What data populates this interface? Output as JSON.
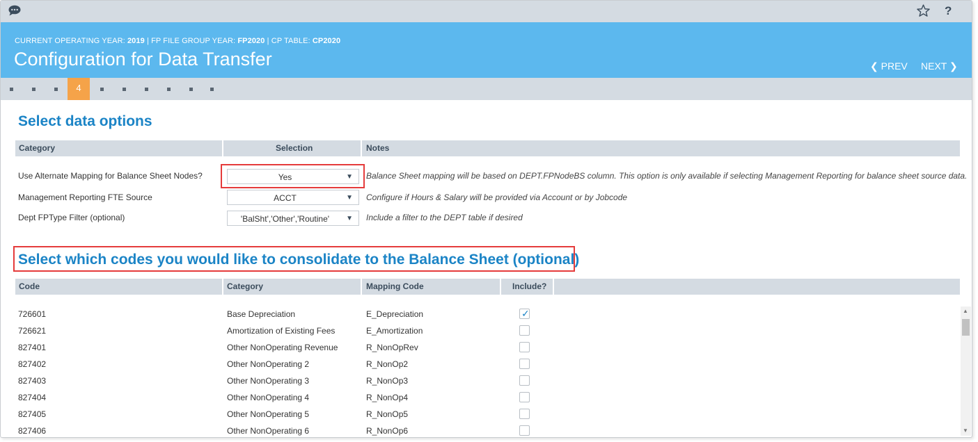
{
  "header": {
    "meta_year_label": "CURRENT OPERATING YEAR:",
    "meta_year": "2019",
    "meta_fp_label": "| FP FILE GROUP YEAR:",
    "meta_fp": "FP2020",
    "meta_cp_label": "| CP TABLE:",
    "meta_cp": "CP2020",
    "title": "Configuration for Data Transfer",
    "prev": "PREV",
    "next": "NEXT",
    "help": "?"
  },
  "steps": {
    "current": "4"
  },
  "options_section": {
    "title": "Select data options",
    "columns": [
      "Category",
      "Selection",
      "Notes"
    ],
    "rows": [
      {
        "label": "Use Alternate Mapping for Balance Sheet Nodes?",
        "selection": "Yes",
        "note": "Balance Sheet mapping will be based on DEPT.FPNodeBS column. This option is only available if selecting Management Reporting for balance sheet source data."
      },
      {
        "label": "Management Reporting FTE Source",
        "selection": "ACCT",
        "note": "Configure if Hours & Salary will be provided via Account or by Jobcode"
      },
      {
        "label": "Dept FPType Filter (optional)",
        "selection": "'BalSht','Other','Routine'",
        "note": "Include a filter to the DEPT table if desired"
      }
    ]
  },
  "codes_section": {
    "title": "Select which codes you would like to consolidate to the Balance Sheet (optional)",
    "columns": [
      "Code",
      "Category",
      "Mapping Code",
      "Include?"
    ],
    "rows": [
      {
        "code": "726601",
        "category": "Base Depreciation",
        "mapping": "E_Depreciation",
        "include": true
      },
      {
        "code": "726621",
        "category": "Amortization of Existing Fees",
        "mapping": "E_Amortization",
        "include": false
      },
      {
        "code": "827401",
        "category": "Other NonOperating Revenue",
        "mapping": "R_NonOpRev",
        "include": false
      },
      {
        "code": "827402",
        "category": "Other NonOperating 2",
        "mapping": "R_NonOp2",
        "include": false
      },
      {
        "code": "827403",
        "category": "Other NonOperating 3",
        "mapping": "R_NonOp3",
        "include": false
      },
      {
        "code": "827404",
        "category": "Other NonOperating 4",
        "mapping": "R_NonOp4",
        "include": false
      },
      {
        "code": "827405",
        "category": "Other NonOperating 5",
        "mapping": "R_NonOp5",
        "include": false
      },
      {
        "code": "827406",
        "category": "Other NonOperating 6",
        "mapping": "R_NonOp6",
        "include": false
      }
    ]
  },
  "colors": {
    "accent": "#1b84c6",
    "banner": "#5cb8ee",
    "current_step": "#f5a349",
    "highlight": "#e53b3b"
  }
}
